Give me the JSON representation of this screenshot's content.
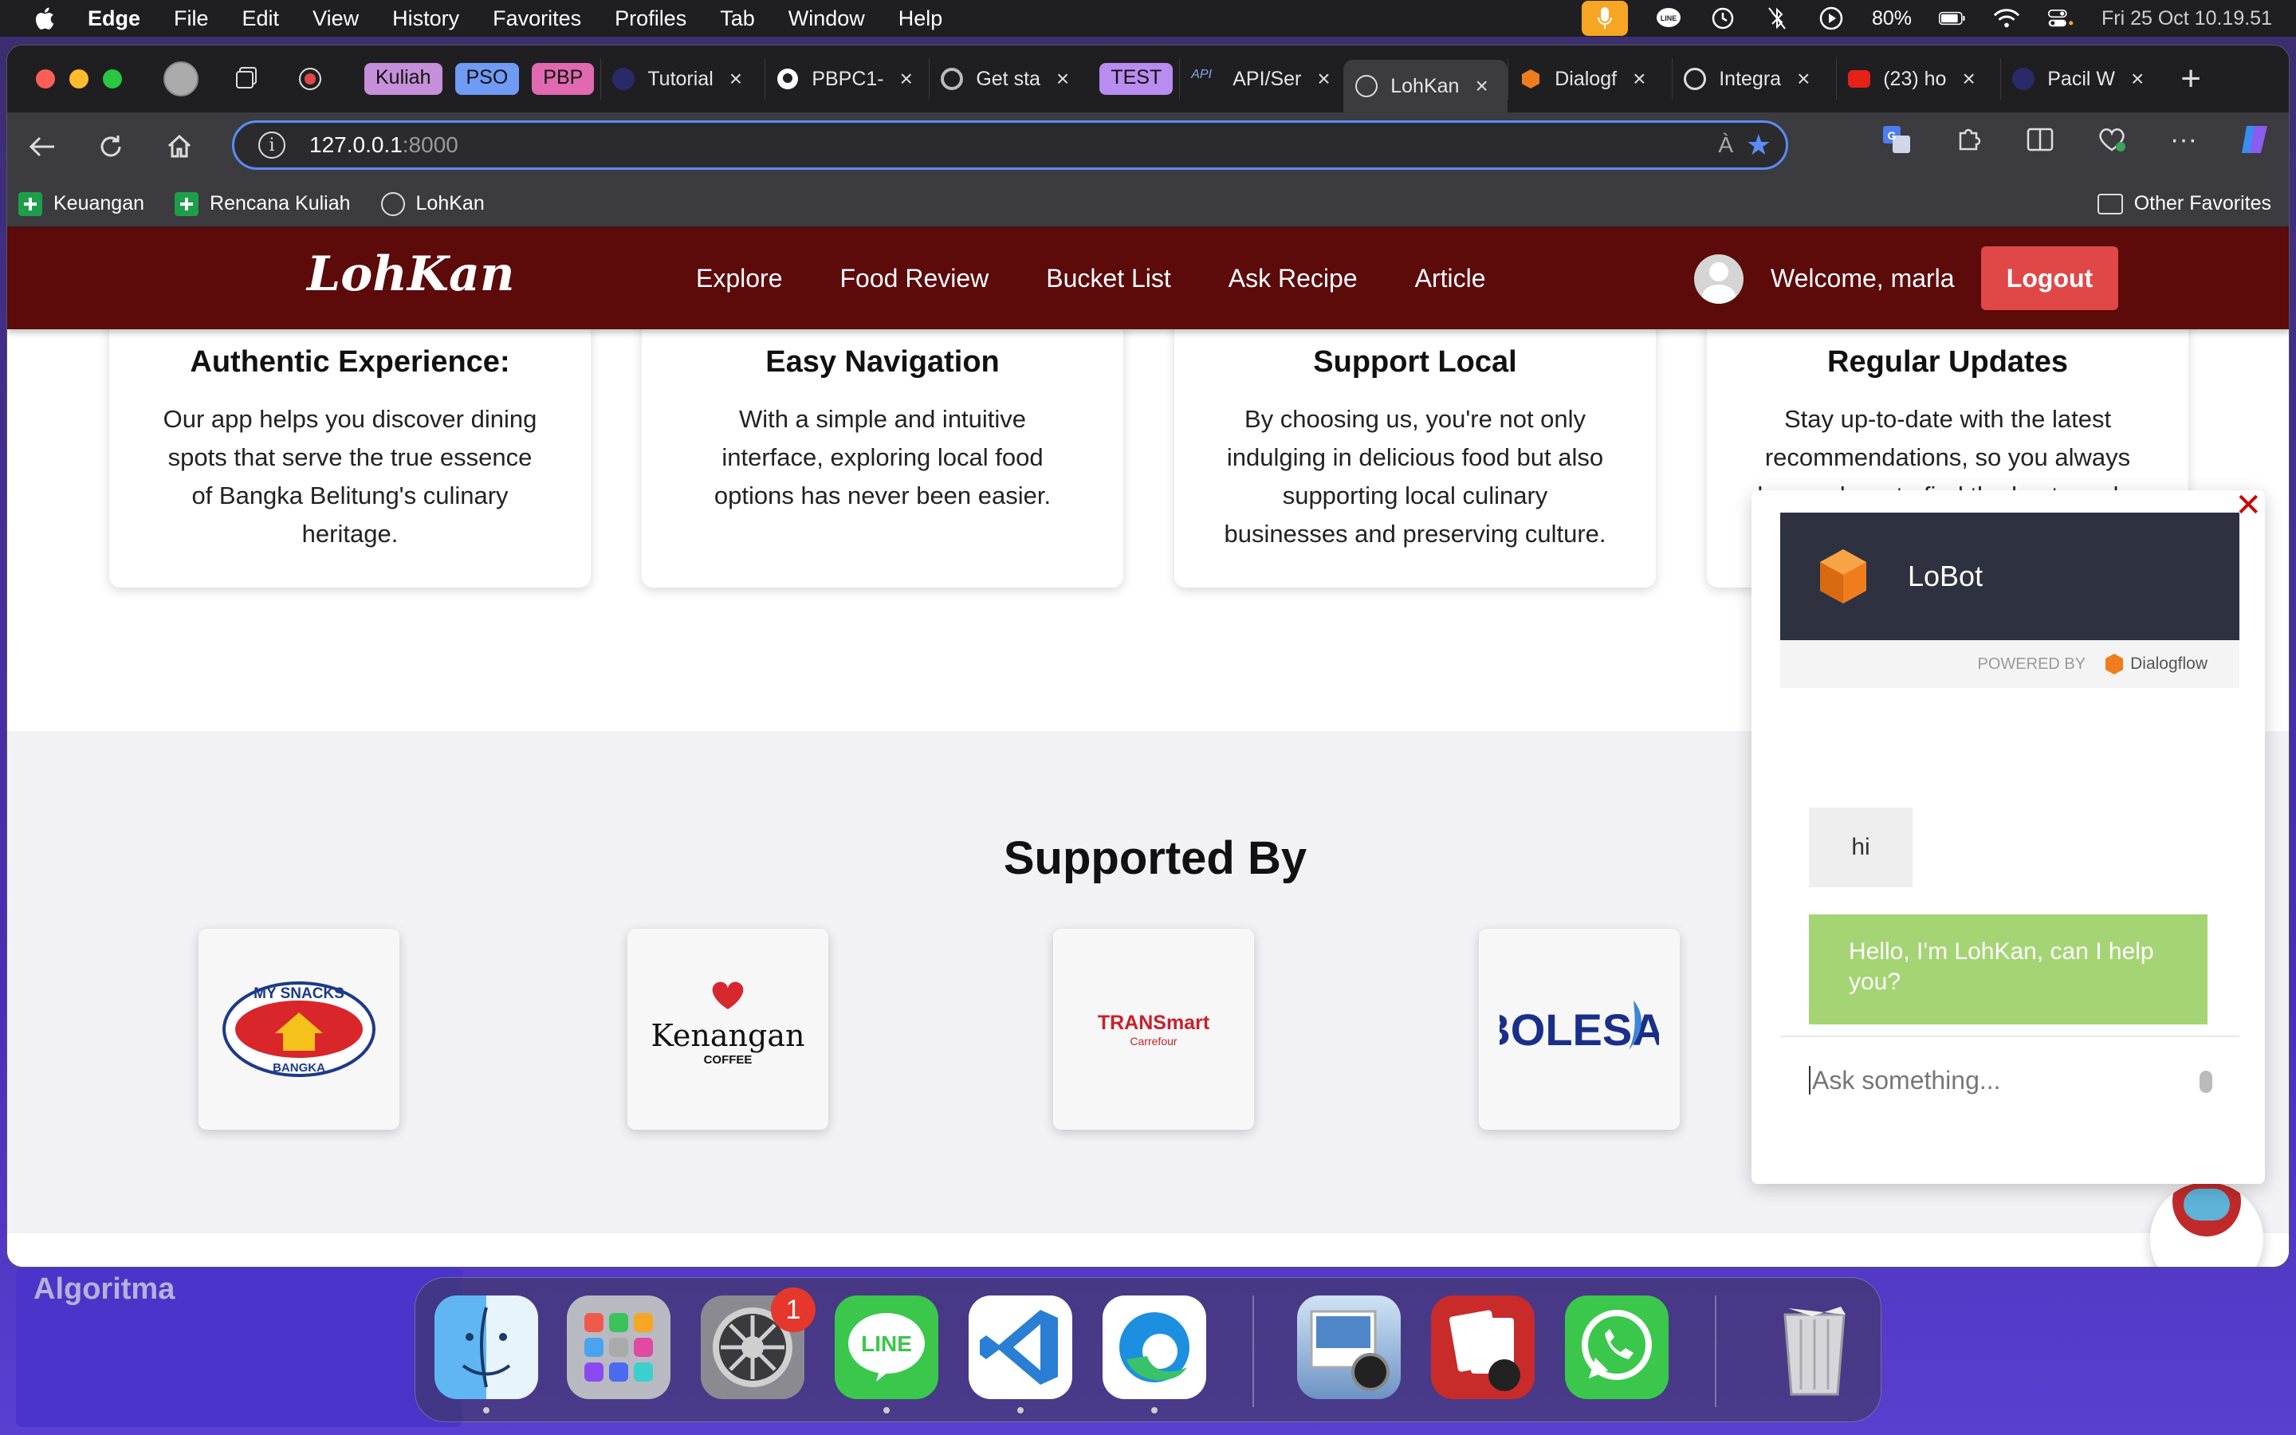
{
  "menubar": {
    "app": "Edge",
    "items": [
      "File",
      "Edit",
      "View",
      "History",
      "Favorites",
      "Profiles",
      "Tab",
      "Window",
      "Help"
    ],
    "battery": "80%",
    "datetime": "Fri 25 Oct  10.19.51"
  },
  "tabs": {
    "groups": [
      {
        "label": "Kuliah",
        "color": "#c58fd9"
      },
      {
        "label": "PSO",
        "color": "#6f9bf4"
      },
      {
        "label": "PBP",
        "color": "#e069b0"
      },
      {
        "label": "TEST",
        "color": "#b98cf0"
      }
    ],
    "items": [
      {
        "label": "Tutorial",
        "x": "×"
      },
      {
        "label": "PBPC1-",
        "x": "×"
      },
      {
        "label": "Get sta",
        "x": "×"
      },
      {
        "label": "API/Ser",
        "x": "×"
      },
      {
        "label": "LohKan",
        "x": "×"
      },
      {
        "label": "Dialogf",
        "x": "×"
      },
      {
        "label": "Integra",
        "x": "×"
      },
      {
        "label": "(23) ho",
        "x": "×"
      },
      {
        "label": "Pacil W",
        "x": "×"
      }
    ],
    "new_tab": "+"
  },
  "address": {
    "host": "127.0.0.1",
    "port": ":8000",
    "read_aloud": "À",
    "info": "i"
  },
  "bookmarks": {
    "items": [
      "Keuangan",
      "Rencana Kuliah",
      "LohKan"
    ],
    "other": "Other Favorites"
  },
  "site": {
    "logo": "LohKan",
    "nav": [
      "Explore",
      "Food Review",
      "Bucket List",
      "Ask Recipe",
      "Article"
    ],
    "welcome": "Welcome, marla",
    "logout": "Logout"
  },
  "features": [
    {
      "title": "Authentic Experience:",
      "lines": [
        "Our app helps you discover dining",
        "spots that serve the true essence",
        "of Bangka Belitung's culinary",
        "heritage."
      ]
    },
    {
      "title": "Easy Navigation",
      "lines": [
        "With a simple and intuitive",
        "interface, exploring local food",
        "options has never been easier."
      ]
    },
    {
      "title": "Support Local",
      "lines": [
        "By choosing us, you're not only",
        "indulging in delicious food but also",
        "supporting local culinary",
        "businesses and preserving culture."
      ]
    },
    {
      "title": "Regular Updates",
      "lines": [
        "Stay up-to-date with the latest",
        "recommendations, so you always",
        "know where to find the best meals."
      ]
    }
  ],
  "supported": {
    "title": "Supported By",
    "sponsors": [
      {
        "name": "My Snacks Bangka",
        "top": "MY SNACKS",
        "bottom": "BANGKA"
      },
      {
        "name": "Kenangan Coffee",
        "top": "Kenangan",
        "bottom": "COFFEE"
      },
      {
        "name": "Transmart Carrefour",
        "top": "TRANSmart",
        "bottom": "Carrefour"
      },
      {
        "name": "Bolesa",
        "top": "BOLESA",
        "bottom": ""
      }
    ]
  },
  "chatbot": {
    "title": "LoBot",
    "powered_by": "POWERED BY",
    "powered_name": "Dialogflow",
    "close": "✕",
    "messages": [
      {
        "from": "user",
        "text": "hi"
      },
      {
        "from": "bot",
        "text": "Hello, I'm LohKan, can I help you?"
      }
    ],
    "input_placeholder": "Ask something..."
  },
  "wallpaper": {
    "label": "Algoritma"
  },
  "dock": {
    "apps": [
      "Finder",
      "Launchpad",
      "System Settings",
      "LINE",
      "Visual Studio Code",
      "Microsoft Edge",
      "Preview",
      "Photo Booth",
      "WhatsApp",
      "Trash"
    ],
    "settings_badge": "1",
    "line_label": "LINE"
  }
}
